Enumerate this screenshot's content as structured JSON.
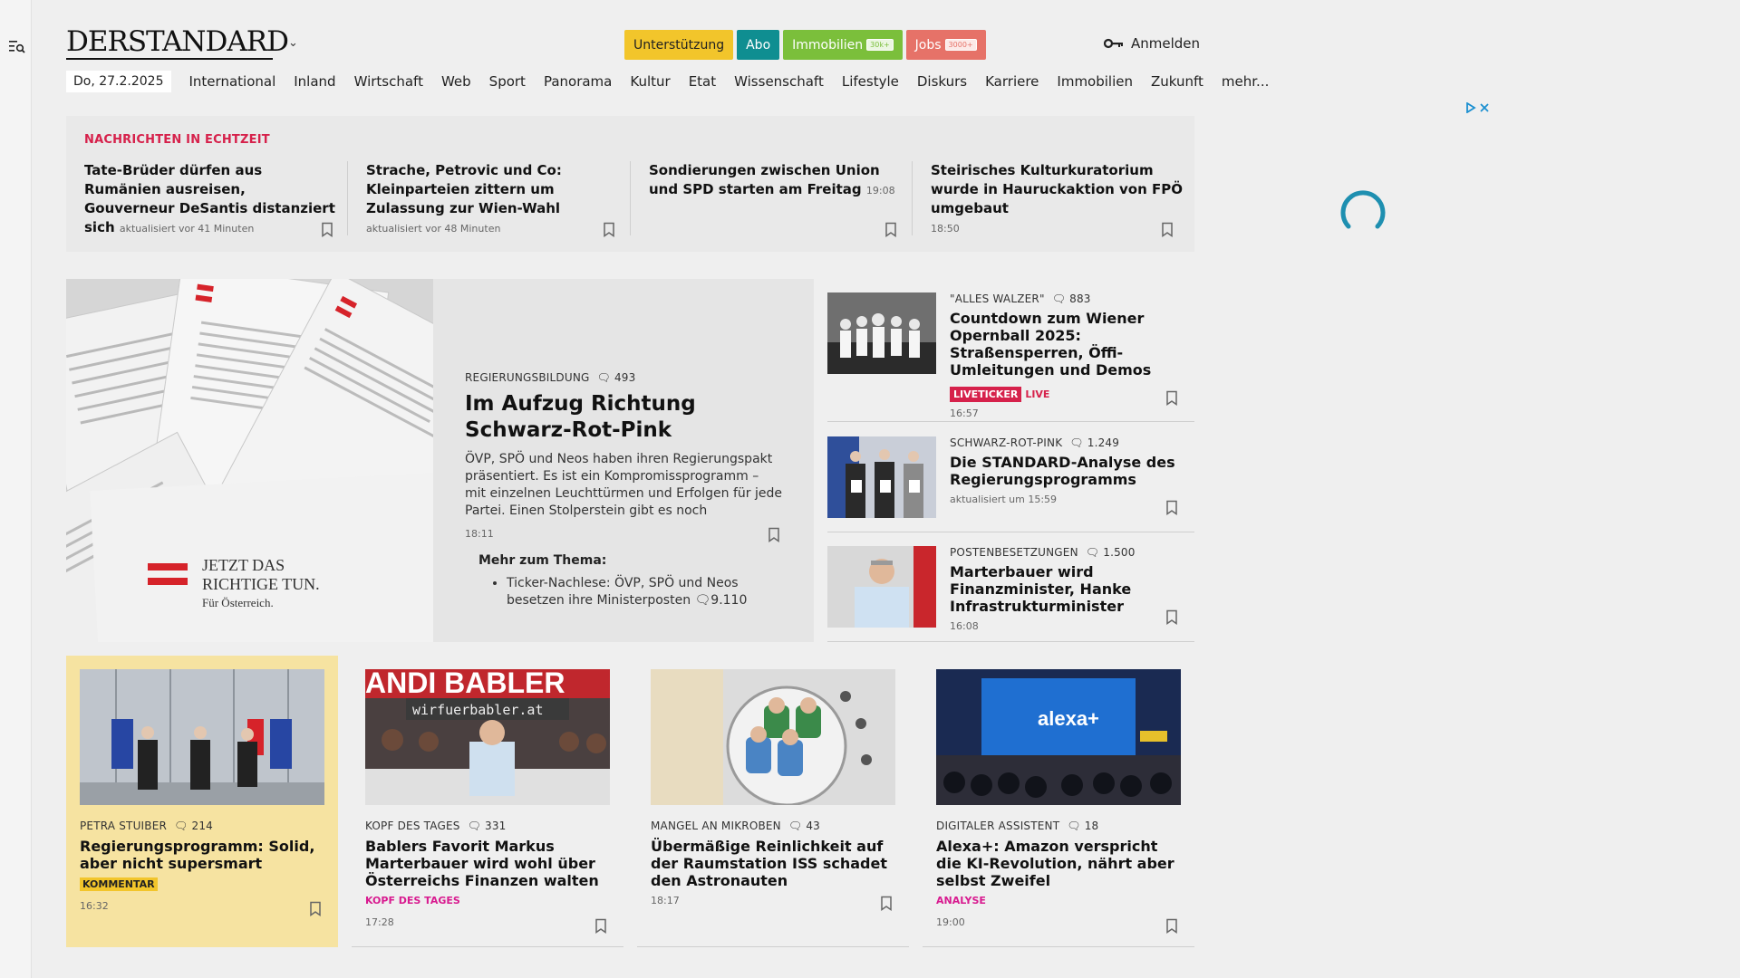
{
  "header": {
    "logo": "DERSTANDARD",
    "buttons": [
      {
        "label": "Unterstützung",
        "badge": ""
      },
      {
        "label": "Abo",
        "badge": ""
      },
      {
        "label": "Immobilien",
        "badge": "30k+"
      },
      {
        "label": "Jobs",
        "badge": "3000+"
      }
    ],
    "login_label": "Anmelden"
  },
  "nav": {
    "date": "Do, 27.2.2025",
    "items": [
      "International",
      "Inland",
      "Wirtschaft",
      "Web",
      "Sport",
      "Panorama",
      "Kultur",
      "Etat",
      "Wissenschaft",
      "Lifestyle",
      "Diskurs",
      "Karriere",
      "Immobilien",
      "Zukunft",
      "mehr..."
    ]
  },
  "ticker": {
    "heading": "NACHRICHTEN IN ECHTZEIT",
    "items": [
      {
        "title": "Tate-Brüder dürfen aus Rumänien ausreisen, Gouverneur DeSantis distanziert sich",
        "time": "aktualisiert vor 41 Minuten"
      },
      {
        "title": "Strache, Petrovic und Co: Kleinparteien zittern um Zulassung zur Wien-Wahl",
        "time": "aktualisiert vor 48 Minuten"
      },
      {
        "title": "Sondierungen zwischen Union und SPD starten am Freitag",
        "time": "19:08"
      },
      {
        "title": "Steirisches Kulturkuratorium wurde in Hauruckaktion von FPÖ umgebaut",
        "time": "18:50"
      }
    ]
  },
  "hero": {
    "kicker": "REGIERUNGSBILDUNG",
    "comments": "493",
    "title": "Im Aufzug Richtung Schwarz-Rot-Pink",
    "teaser": "ÖVP, SPÖ und Neos haben ihren Regierungspakt präsentiert. Es ist ein Kompromissprogramm – mit einzelnen Leuchttürmen und Erfolgen für jede Partei. Einen Stolperstein gibt es noch",
    "time": "18:11",
    "more_heading": "Mehr zum Thema:",
    "more_item": "Ticker-Nachlese: ÖVP, SPÖ und Neos besetzen ihre Ministerposten",
    "more_comments": "9.110",
    "image_text_1": "JETZT DAS",
    "image_text_2": "RICHTIGE TUN.",
    "image_text_3": "Für Österreich."
  },
  "side": [
    {
      "kicker": "\"ALLES WALZER\"",
      "comments": "883",
      "title": "Countdown zum Wiener Opernball 2025: Straßensperren, Öffi-Umleitungen und Demos",
      "tag": "LIVETICKER",
      "live": "LIVE",
      "time": "16:57"
    },
    {
      "kicker": "SCHWARZ-ROT-PINK",
      "comments": "1.249",
      "title": "Die STANDARD-Analyse des Regierungsprogramms",
      "time": "aktualisiert um 15:59"
    },
    {
      "kicker": "POSTENBESETZUNGEN",
      "comments": "1.500",
      "title": "Marterbauer wird Finanzminister, Hanke Infrastrukturminister",
      "time": "16:08"
    }
  ],
  "cards": [
    {
      "kicker": "PETRA STUIBER",
      "comments": "214",
      "title": "Regierungsprogramm: Solid, aber nicht supersmart",
      "tag": "KOMMENTAR",
      "time": "16:32"
    },
    {
      "kicker": "KOPF DES TAGES",
      "comments": "331",
      "title": "Bablers Favorit Markus Marterbauer wird wohl über Österreichs Finanzen walten",
      "tag": "KOPF DES TAGES",
      "time": "17:28",
      "image_text_1": "ANDI BABLER",
      "image_text_2": "wirfuerbabler.at"
    },
    {
      "kicker": "MANGEL AN MIKROBEN",
      "comments": "43",
      "title": "Übermäßige Reinlichkeit auf der Raumstation ISS schadet den Astronauten",
      "time": "18:17"
    },
    {
      "kicker": "DIGITALER ASSISTENT",
      "comments": "18",
      "title": "Alexa+: Amazon verspricht die KI-Revolution, nährt aber selbst Zweifel",
      "tag": "ANALYSE",
      "time": "19:00",
      "image_text_1": "alexa+"
    }
  ],
  "colors": {
    "accent_red": "#d6214b",
    "accent_pink": "#d81a8f",
    "highlight": "#f6e3a1"
  }
}
